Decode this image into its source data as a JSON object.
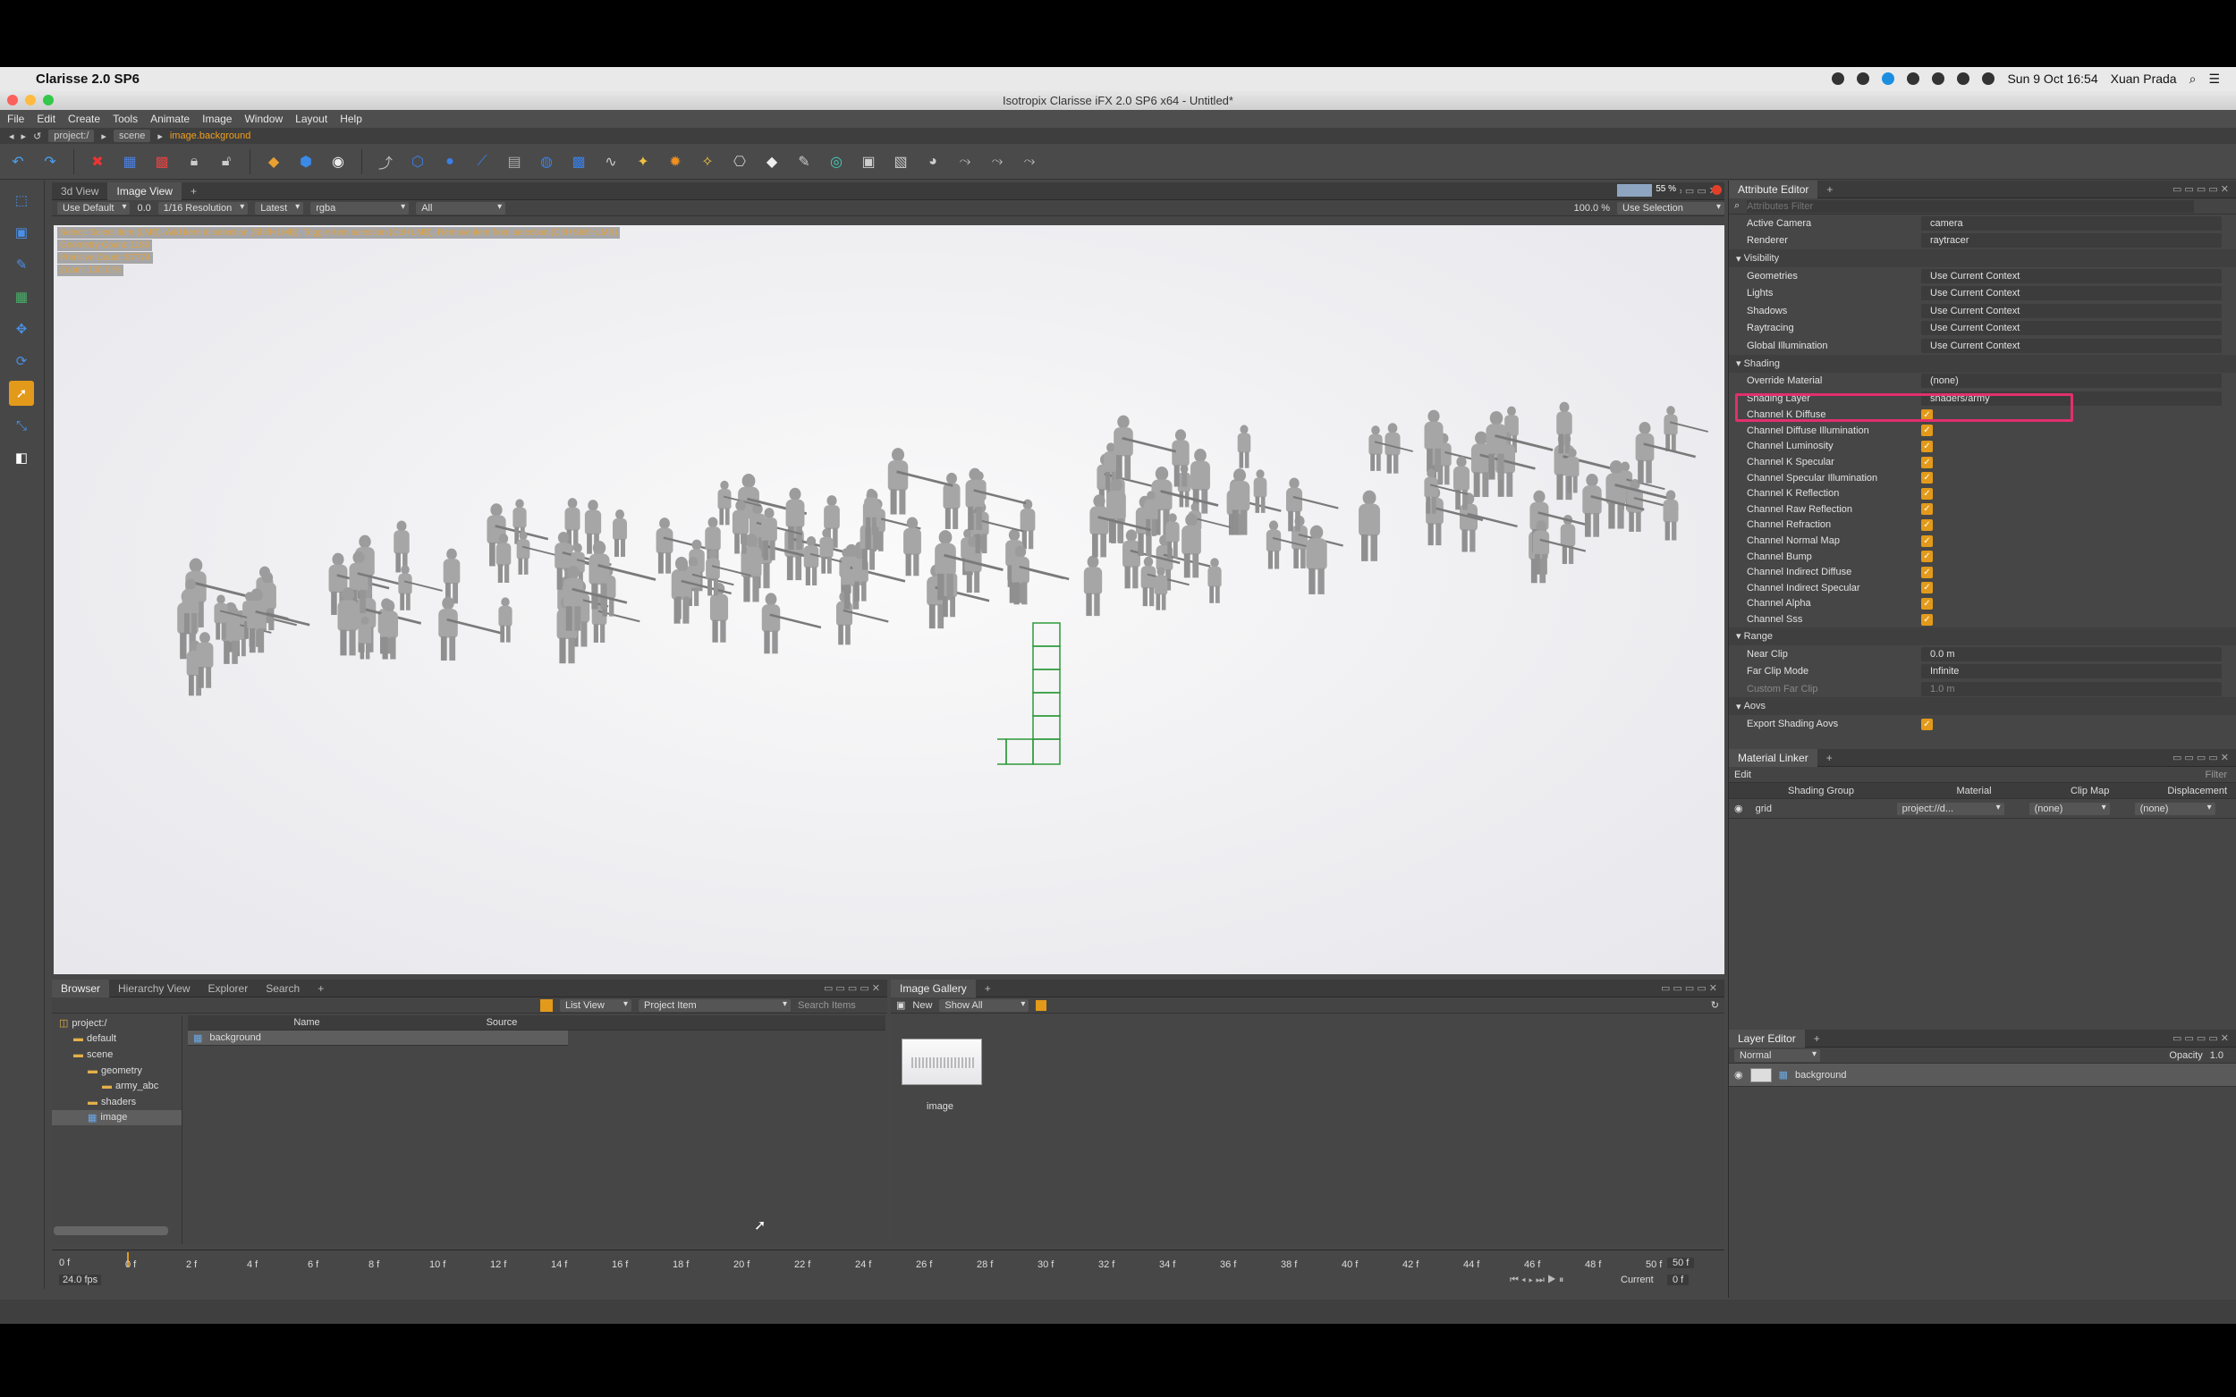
{
  "mac": {
    "app_name": "Clarisse 2.0 SP6",
    "clock": "Sun 9 Oct  16:54",
    "user": "Xuan Prada"
  },
  "window": {
    "title": "Isotropix Clarisse iFX 2.0 SP6 x64 - Untitled*"
  },
  "menu": [
    "File",
    "Edit",
    "Create",
    "Tools",
    "Animate",
    "Image",
    "Window",
    "Layout",
    "Help"
  ],
  "path": {
    "items": [
      "project:/",
      "scene"
    ],
    "active": "image.background"
  },
  "viewport": {
    "tabs": [
      "3d View",
      "Image View"
    ],
    "active_tab": "Image View",
    "display": "Use Default",
    "exposure": "0.0",
    "resolution": "1/16 Resolution",
    "version": "Latest",
    "channel": "rgba",
    "layers": "All",
    "zoom": "100.0 %",
    "selection": "Use Selection",
    "progress": "55 %",
    "progress_value": 0.55,
    "hud": [
      "Select: Select item (LMB). Add item to selection (Shift+LMB). Toggle item selection (Ctrl+LMB). Remove item from selection (Ctrl+Shift+LMB)",
      "Geometry Count: 1180",
      "Primitive Count: 57774",
      "Zoom: 100.0 %"
    ]
  },
  "attr": {
    "title": "Attribute Editor",
    "filter_placeholder": "Attributes Filter",
    "top_rows": [
      {
        "label": "Active Camera",
        "value": "camera"
      },
      {
        "label": "Renderer",
        "value": "raytracer"
      }
    ],
    "visibility": {
      "title": "Visibility",
      "rows": [
        {
          "label": "Geometries",
          "value": "Use Current Context"
        },
        {
          "label": "Lights",
          "value": "Use Current Context"
        },
        {
          "label": "Shadows",
          "value": "Use Current Context"
        },
        {
          "label": "Raytracing",
          "value": "Use Current Context"
        },
        {
          "label": "Global Illumination",
          "value": "Use Current Context"
        }
      ]
    },
    "shading": {
      "title": "Shading",
      "override_label": "Override Material",
      "override_value": "(none)",
      "layer_label": "Shading Layer",
      "layer_value": "shaders/army",
      "channels": [
        "Channel K Diffuse",
        "Channel Diffuse Illumination",
        "Channel Luminosity",
        "Channel K Specular",
        "Channel Specular Illumination",
        "Channel K Reflection",
        "Channel Raw Reflection",
        "Channel Refraction",
        "Channel Normal Map",
        "Channel Bump",
        "Channel Indirect Diffuse",
        "Channel Indirect Specular",
        "Channel Alpha",
        "Channel Sss"
      ]
    },
    "range": {
      "title": "Range",
      "near_label": "Near Clip",
      "near_value": "0.0 m",
      "far_mode_label": "Far Clip Mode",
      "far_mode_value": "Infinite",
      "custom_far_label": "Custom Far Clip",
      "custom_far_value": "1.0 m"
    },
    "aovs": {
      "title": "Aovs",
      "export_label": "Export Shading Aovs"
    }
  },
  "material_linker": {
    "title": "Material Linker",
    "edit_label": "Edit",
    "filter_placeholder": "Filter",
    "columns": [
      "Shading Group",
      "Material",
      "Clip Map",
      "Displacement"
    ],
    "row": {
      "group": "grid",
      "material": "project://d...",
      "clip": "(none)",
      "disp": "(none)"
    }
  },
  "layer_editor": {
    "title": "Layer Editor",
    "blend": "Normal",
    "opacity_label": "Opacity",
    "opacity_value": "1.0",
    "layer": "background"
  },
  "browser": {
    "tabs": [
      "Browser",
      "Hierarchy View",
      "Explorer",
      "Search"
    ],
    "view": "List View",
    "filter": "Project Item",
    "search_placeholder": "Search Items",
    "tree": [
      "project:/",
      "default",
      "scene",
      "geometry",
      "army_abc",
      "shaders",
      "image"
    ],
    "columns": [
      "Name",
      "Source"
    ],
    "row": "background"
  },
  "gallery": {
    "title": "Image Gallery",
    "new_label": "New",
    "show": "Show All",
    "thumb_label": "image"
  },
  "timeline": {
    "start": "0 f",
    "end": "50 f",
    "fps": "24.0 fps",
    "current_label": "Current",
    "current_value": "0 f",
    "ticks": [
      "0 f",
      "2 f",
      "4 f",
      "6 f",
      "8 f",
      "10 f",
      "12 f",
      "14 f",
      "16 f",
      "18 f",
      "20 f",
      "22 f",
      "24 f",
      "26 f",
      "28 f",
      "30 f",
      "32 f",
      "34 f",
      "36 f",
      "38 f",
      "40 f",
      "42 f",
      "44 f",
      "46 f",
      "48 f",
      "50 f"
    ]
  },
  "colors": {
    "accent": "#e39a1a",
    "highlight": "#e22f6d",
    "grid_wire": "#2e9a3a"
  }
}
